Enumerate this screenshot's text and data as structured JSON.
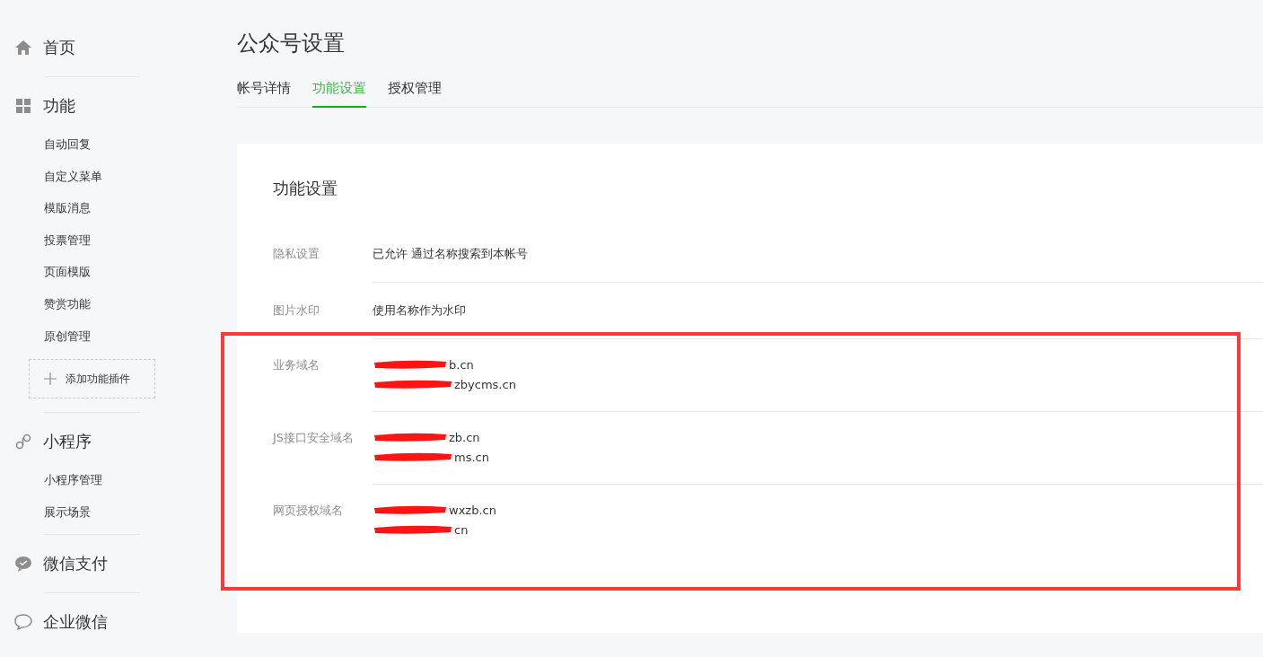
{
  "sidebar": {
    "sections": [
      {
        "label": "首页",
        "kind": "home"
      },
      {
        "label": "功能",
        "kind": "grid",
        "items": [
          "自动回复",
          "自定义菜单",
          "模版消息",
          "投票管理",
          "页面模版",
          "赞赏功能",
          "原创管理"
        ],
        "add_button": "添加功能插件"
      },
      {
        "label": "小程序",
        "kind": "link",
        "items": [
          "小程序管理",
          "展示场景"
        ]
      },
      {
        "label": "微信支付",
        "kind": "pay"
      },
      {
        "label": "企业微信",
        "kind": "chat"
      }
    ]
  },
  "page_title": "公众号设置",
  "tabs": [
    {
      "label": "帐号详情",
      "selected": false
    },
    {
      "label": "功能设置",
      "selected": true
    },
    {
      "label": "授权管理",
      "selected": false
    }
  ],
  "card": {
    "title": "功能设置",
    "rows": [
      {
        "label": "隐私设置",
        "values": [
          "已允许 通过名称搜索到本帐号"
        ],
        "redacted": false
      },
      {
        "label": "图片水印",
        "values": [
          "使用名称作为水印"
        ],
        "redacted": false
      },
      {
        "label": "业务域名",
        "values": [
          "b.cn",
          "zbycms.cn"
        ],
        "redacted": true
      },
      {
        "label": "JS接口安全域名",
        "values": [
          "zb.cn",
          "ms.cn"
        ],
        "redacted": true
      },
      {
        "label": "网页授权域名",
        "values": [
          "wxzb.cn",
          "cn"
        ],
        "redacted": true
      }
    ]
  },
  "annotation": {
    "kind": "highlight-frame"
  }
}
